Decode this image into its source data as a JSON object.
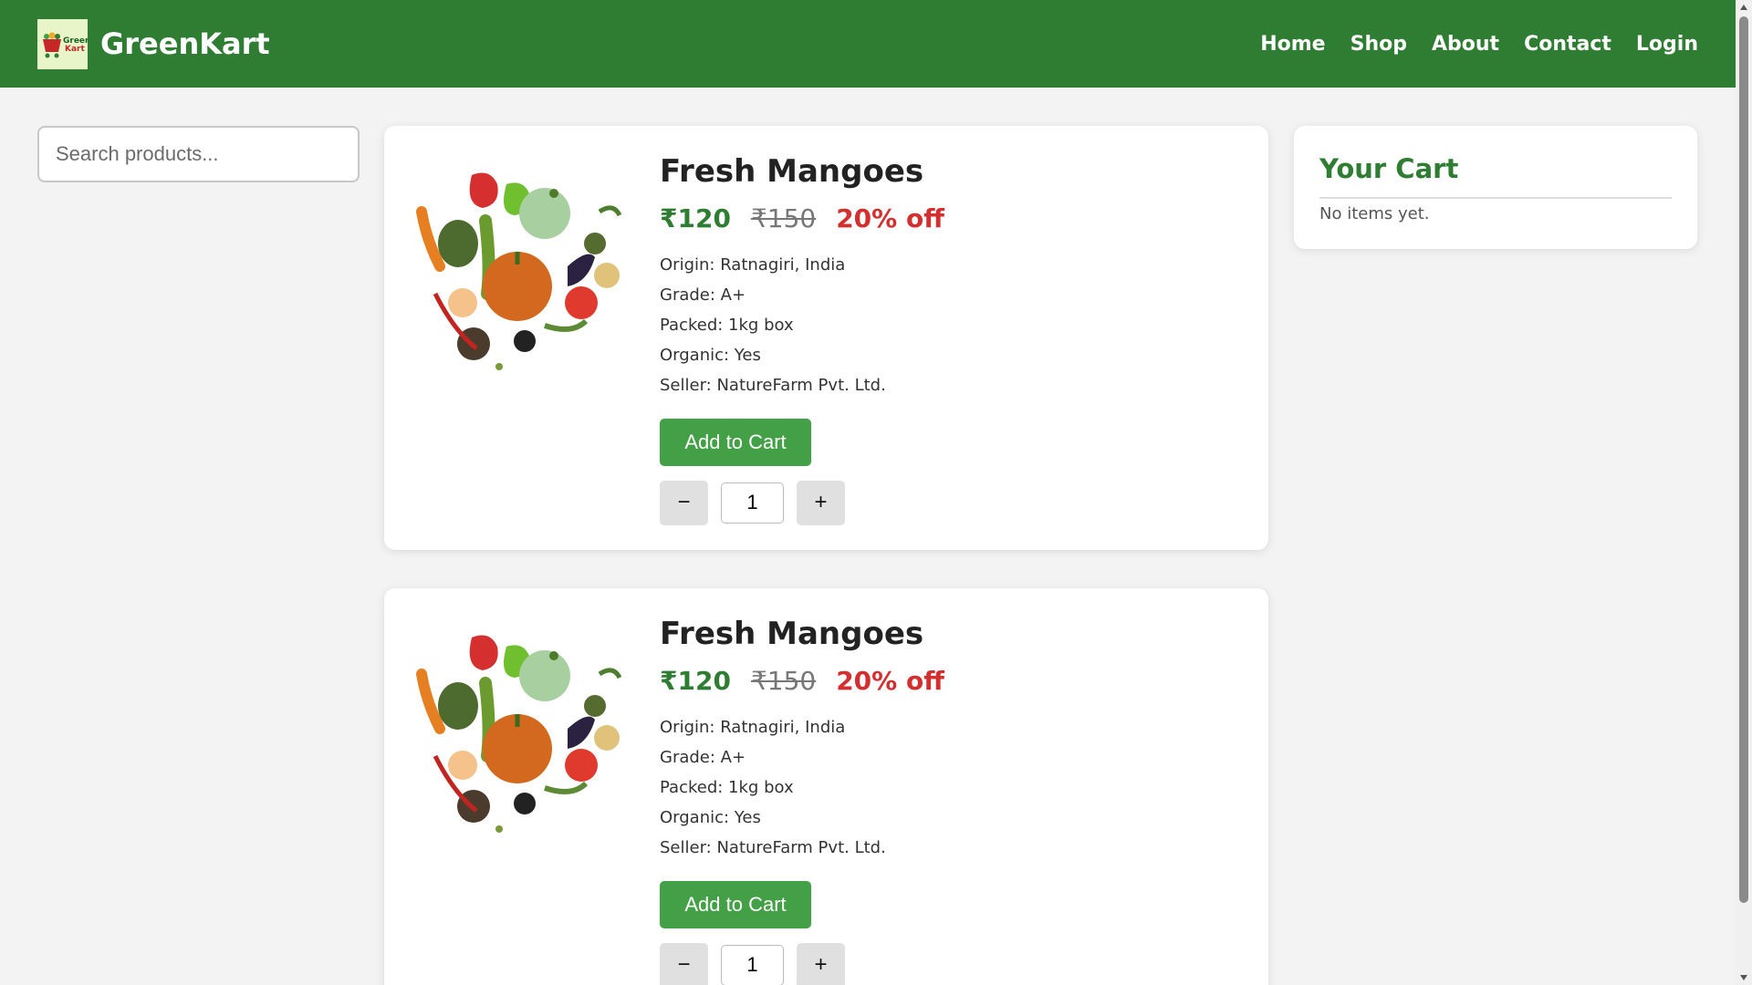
{
  "header": {
    "brand": "GreenKart",
    "logo_text_line1": "Green",
    "logo_text_line2": "Kart",
    "nav": [
      "Home",
      "Shop",
      "About",
      "Contact",
      "Login"
    ]
  },
  "search": {
    "placeholder": "Search products..."
  },
  "products": [
    {
      "title": "Fresh Mangoes",
      "price": "₹120",
      "old_price": "₹150",
      "discount": "20% off",
      "details": [
        "Origin: Ratnagiri, India",
        "Grade: A+",
        "Packed: 1kg box",
        "Organic: Yes",
        "Seller: NatureFarm Pvt. Ltd."
      ],
      "add_label": "Add to Cart",
      "minus": "−",
      "plus": "+",
      "quantity": "1"
    },
    {
      "title": "Fresh Mangoes",
      "price": "₹120",
      "old_price": "₹150",
      "discount": "20% off",
      "details": [
        "Origin: Ratnagiri, India",
        "Grade: A+",
        "Packed: 1kg box",
        "Organic: Yes",
        "Seller: NatureFarm Pvt. Ltd."
      ],
      "add_label": "Add to Cart",
      "minus": "−",
      "plus": "+",
      "quantity": "1"
    }
  ],
  "cart": {
    "title": "Your Cart",
    "empty_text": "No items yet."
  },
  "colors": {
    "primary": "#2e7d32",
    "button": "#43a047",
    "discount": "#d32f2f",
    "background": "#f3f3f3"
  }
}
